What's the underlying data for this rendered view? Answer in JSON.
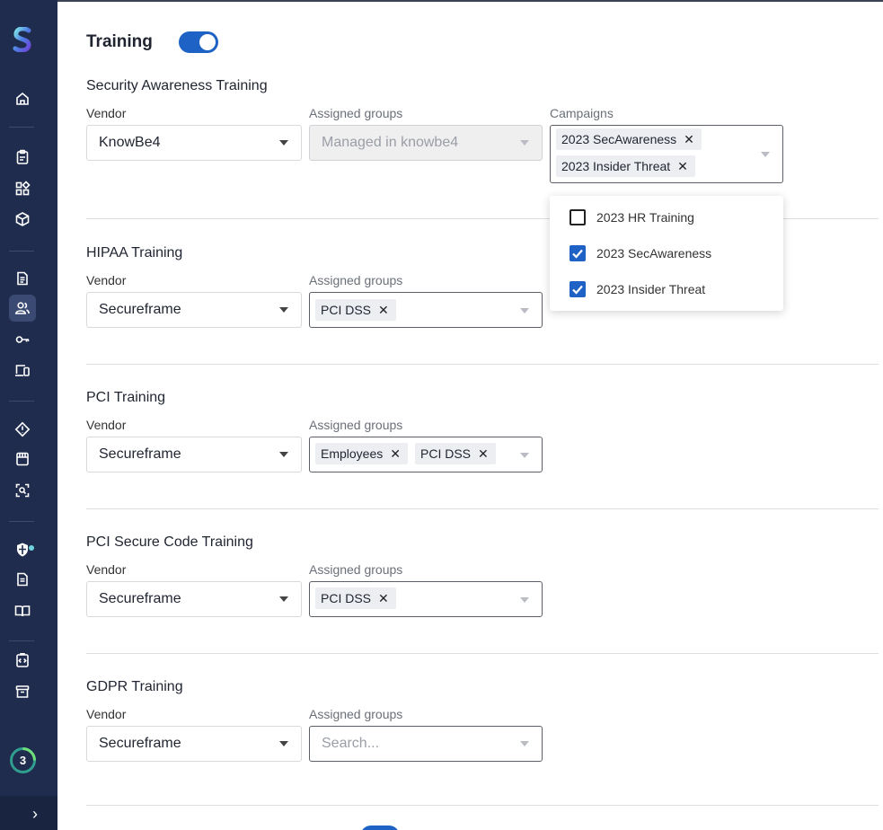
{
  "sidebar": {
    "items": [
      {
        "name": "home-icon"
      },
      {
        "name": "clipboard-icon"
      },
      {
        "name": "grid-icon"
      },
      {
        "name": "box-icon"
      },
      {
        "name": "document-icon"
      },
      {
        "name": "people-icon"
      },
      {
        "name": "key-icon"
      },
      {
        "name": "devices-icon"
      },
      {
        "name": "alert-diamond-icon"
      },
      {
        "name": "store-icon"
      },
      {
        "name": "scan-icon"
      },
      {
        "name": "shield-icon"
      },
      {
        "name": "policy-icon"
      },
      {
        "name": "book-icon"
      },
      {
        "name": "code-icon"
      },
      {
        "name": "archive-icon"
      }
    ],
    "badge_count": "3",
    "collapse_glyph": "›"
  },
  "page": {
    "title": "Training",
    "toggle_on": true
  },
  "sections": [
    {
      "title": "Security Awareness Training",
      "vendor_label": "Vendor",
      "vendor_value": "KnowBe4",
      "groups_label": "Assigned groups",
      "groups_placeholder": "Managed in knowbe4",
      "campaigns_label": "Campaigns",
      "campaigns": [
        "2023 SecAwareness",
        "2023 Insider Threat"
      ]
    },
    {
      "title": "HIPAA Training",
      "vendor_label": "Vendor",
      "vendor_value": "Secureframe",
      "groups_label": "Assigned groups",
      "groups": [
        "PCI DSS"
      ]
    },
    {
      "title": "PCI Training",
      "vendor_label": "Vendor",
      "vendor_value": "Secureframe",
      "groups_label": "Assigned groups",
      "groups": [
        "Employees",
        "PCI DSS"
      ]
    },
    {
      "title": "PCI Secure Code Training",
      "vendor_label": "Vendor",
      "vendor_value": "Secureframe",
      "groups_label": "Assigned groups",
      "groups": [
        "PCI DSS"
      ]
    },
    {
      "title": "GDPR Training",
      "vendor_label": "Vendor",
      "vendor_value": "Secureframe",
      "groups_label": "Assigned groups",
      "groups_placeholder": "Search..."
    }
  ],
  "campaign_dropdown": {
    "options": [
      {
        "label": "2023 HR Training",
        "checked": false
      },
      {
        "label": "2023 SecAwareness",
        "checked": true
      },
      {
        "label": "2023 Insider Threat",
        "checked": true
      }
    ]
  },
  "chip_remove_glyph": "✕",
  "colors": {
    "sidebar_bg": "#1f2c4d",
    "accent": "#1d62c4",
    "badge_ring": "#2f9e8f"
  }
}
